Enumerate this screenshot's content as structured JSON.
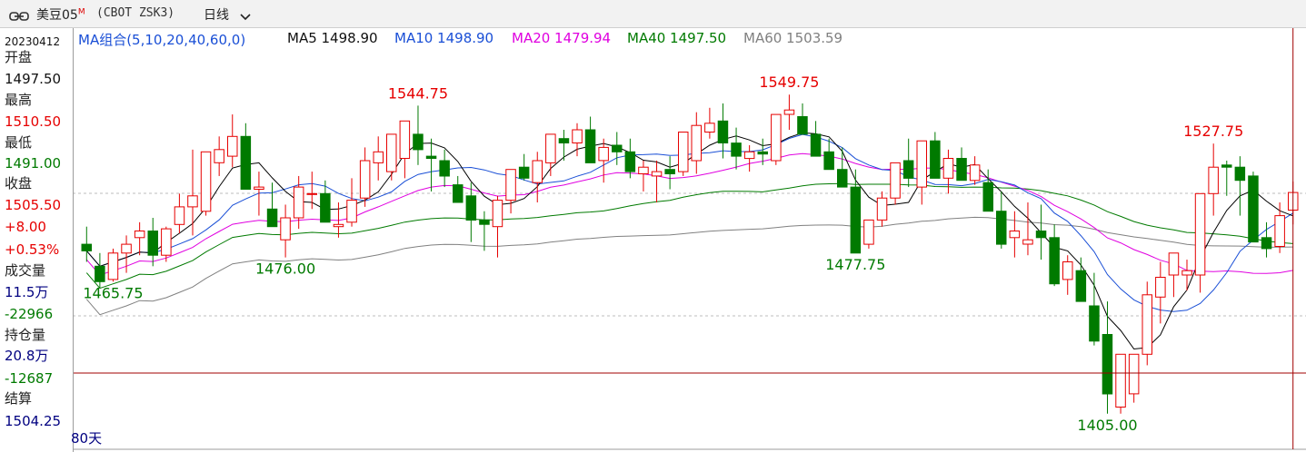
{
  "header": {
    "symbol": "美豆05",
    "symbol_sup": "M",
    "code": "(CBOT ZSK3)",
    "period": "日线",
    "link_icon": "link-icon",
    "dropdown_icon": "chevron-down-icon"
  },
  "left_panel": {
    "date": "20230412",
    "open_label": "开盘",
    "open": "1497.50",
    "high_label": "最高",
    "high": "1510.50",
    "low_label": "最低",
    "low": "1491.00",
    "close_label": "收盘",
    "close": "1505.50",
    "change": "+8.00",
    "change_pct": "+0.53%",
    "volume_label": "成交量",
    "volume": "11.5万",
    "volume_change": "-22966",
    "oi_label": "持仓量",
    "oi": "20.8万",
    "oi_change": "-12687",
    "settle_label": "结算",
    "settle": "1504.25"
  },
  "ma_bar": {
    "combo_label": "MA组合(5,10,20,40,60,0)",
    "ma5": "MA5 1498.90",
    "ma10": "MA10 1498.90",
    "ma20": "MA20 1479.94",
    "ma40": "MA40 1497.50",
    "ma60": "MA60 1503.59"
  },
  "footer": {
    "range": "80天"
  },
  "colors": {
    "up": "#e60000",
    "down": "#007a00",
    "ma5": "#000000",
    "ma10": "#1a4fd6",
    "ma20": "#e000e0",
    "ma40": "#007a00",
    "ma60": "#808080"
  },
  "chart_data": {
    "type": "candlestick",
    "title": "美豆05 (CBOT ZSK3) 日线",
    "ylim": [
      1395,
      1560
    ],
    "ohlc": [
      [
        1482,
        1490,
        1474,
        1479
      ],
      [
        1472,
        1478,
        1462,
        1465
      ],
      [
        1466,
        1480,
        1465,
        1478
      ],
      [
        1478,
        1486,
        1469,
        1482
      ],
      [
        1485,
        1492,
        1477,
        1488
      ],
      [
        1488,
        1494,
        1472,
        1477
      ],
      [
        1477,
        1490,
        1474,
        1489
      ],
      [
        1491,
        1505,
        1487,
        1499
      ],
      [
        1499,
        1525,
        1486,
        1504
      ],
      [
        1497,
        1524,
        1495,
        1524
      ],
      [
        1519,
        1531,
        1513,
        1525
      ],
      [
        1522,
        1541,
        1517,
        1531
      ],
      [
        1531,
        1537,
        1507,
        1507
      ],
      [
        1507,
        1515,
        1495,
        1508
      ],
      [
        1498,
        1510,
        1493,
        1490
      ],
      [
        1484,
        1500,
        1476,
        1494
      ],
      [
        1494,
        1513,
        1489,
        1508
      ],
      [
        1505,
        1515,
        1498,
        1505
      ],
      [
        1505,
        1511,
        1494,
        1492
      ],
      [
        1490,
        1501,
        1485,
        1491
      ],
      [
        1492,
        1512,
        1490,
        1502
      ],
      [
        1503,
        1526,
        1499,
        1520
      ],
      [
        1519,
        1531,
        1511,
        1524
      ],
      [
        1515,
        1532,
        1511,
        1532
      ],
      [
        1521,
        1538,
        1512,
        1538
      ],
      [
        1532,
        1545,
        1518,
        1525
      ],
      [
        1522,
        1530,
        1506,
        1521
      ],
      [
        1520,
        1525,
        1508,
        1513
      ],
      [
        1509,
        1513,
        1501,
        1501
      ],
      [
        1504,
        1510,
        1483,
        1493
      ],
      [
        1493,
        1497,
        1479,
        1491
      ],
      [
        1490,
        1504,
        1476,
        1502
      ],
      [
        1502,
        1513,
        1496,
        1516
      ],
      [
        1517,
        1523,
        1511,
        1512
      ],
      [
        1510,
        1524,
        1501,
        1520
      ],
      [
        1519,
        1532,
        1513,
        1532
      ],
      [
        1530,
        1534,
        1520,
        1528
      ],
      [
        1528,
        1537,
        1522,
        1534
      ],
      [
        1534,
        1540,
        1519,
        1519
      ],
      [
        1520,
        1530,
        1510,
        1526
      ],
      [
        1527,
        1533,
        1518,
        1524
      ],
      [
        1524,
        1530,
        1512,
        1515
      ],
      [
        1514,
        1520,
        1506,
        1517
      ],
      [
        1513,
        1520,
        1501,
        1515
      ],
      [
        1516,
        1522,
        1507,
        1514
      ],
      [
        1515,
        1532,
        1513,
        1533
      ],
      [
        1520,
        1542,
        1514,
        1536
      ],
      [
        1533,
        1544,
        1530,
        1537
      ],
      [
        1538,
        1546,
        1521,
        1528
      ],
      [
        1528,
        1535,
        1516,
        1522
      ],
      [
        1521,
        1527,
        1515,
        1524
      ],
      [
        1524,
        1530,
        1518,
        1523
      ],
      [
        1520,
        1535,
        1518,
        1541
      ],
      [
        1541,
        1550,
        1534,
        1543
      ],
      [
        1540,
        1546,
        1532,
        1532
      ],
      [
        1532,
        1538,
        1522,
        1522
      ],
      [
        1524,
        1530,
        1516,
        1516
      ],
      [
        1516,
        1526,
        1508,
        1508
      ],
      [
        1508,
        1516,
        1478,
        1478
      ],
      [
        1482,
        1493,
        1480,
        1493
      ],
      [
        1493,
        1506,
        1490,
        1503
      ],
      [
        1503,
        1518,
        1500,
        1519
      ],
      [
        1520,
        1530,
        1508,
        1512
      ],
      [
        1508,
        1527,
        1500,
        1529
      ],
      [
        1529,
        1533,
        1512,
        1512
      ],
      [
        1512,
        1525,
        1505,
        1521
      ],
      [
        1521,
        1526,
        1511,
        1511
      ],
      [
        1511,
        1522,
        1509,
        1518
      ],
      [
        1510,
        1516,
        1497,
        1497
      ],
      [
        1497,
        1506,
        1480,
        1482
      ],
      [
        1485,
        1497,
        1476,
        1488
      ],
      [
        1482,
        1501,
        1477,
        1484
      ],
      [
        1488,
        1500,
        1475,
        1485
      ],
      [
        1485,
        1491,
        1463,
        1464
      ],
      [
        1466,
        1477,
        1459,
        1474
      ],
      [
        1470,
        1476,
        1456,
        1456
      ],
      [
        1454,
        1469,
        1436,
        1438
      ],
      [
        1441,
        1456,
        1405,
        1414
      ],
      [
        1408,
        1432,
        1405,
        1432
      ],
      [
        1414,
        1430,
        1410,
        1432
      ],
      [
        1432,
        1465,
        1427,
        1459
      ],
      [
        1458,
        1474,
        1446,
        1467
      ],
      [
        1468,
        1478,
        1458,
        1478
      ],
      [
        1468,
        1475,
        1461,
        1470
      ],
      [
        1468,
        1505,
        1460,
        1505
      ],
      [
        1505,
        1527.75,
        1495,
        1517
      ],
      [
        1518,
        1520,
        1504,
        1517
      ],
      [
        1517,
        1522,
        1495,
        1511
      ],
      [
        1513,
        1515,
        1483,
        1483
      ],
      [
        1485,
        1492,
        1476,
        1480
      ],
      [
        1481,
        1501,
        1478,
        1495
      ],
      [
        1497.5,
        1510.5,
        1491,
        1505.5
      ]
    ],
    "labels": [
      {
        "text": "1544.75",
        "type": "high"
      },
      {
        "text": "1549.75",
        "type": "high"
      },
      {
        "text": "1527.75",
        "type": "high"
      },
      {
        "text": "1465.75",
        "type": "low"
      },
      {
        "text": "1476.00",
        "type": "low"
      },
      {
        "text": "1477.75",
        "type": "low"
      },
      {
        "text": "1405.00",
        "type": "low"
      }
    ]
  }
}
